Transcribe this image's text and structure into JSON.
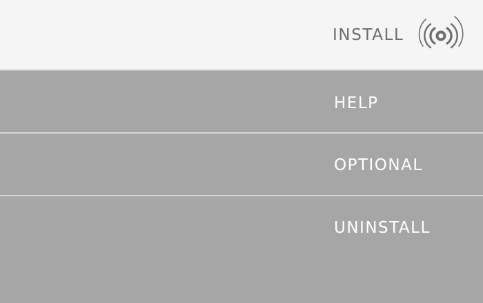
{
  "menu": {
    "install": {
      "label": "INSTALL",
      "icon": "signal-waves-icon",
      "active": true
    },
    "help": {
      "label": "HELP"
    },
    "optional": {
      "label": "OPTIONAL"
    },
    "uninstall": {
      "label": "UNINSTALL"
    }
  },
  "colors": {
    "active_background": "#f5f5f5",
    "active_text": "#6d6d6d",
    "inactive_background": "#a6a6a6",
    "inactive_text": "#ffffff",
    "divider": "#d6d6d6"
  }
}
